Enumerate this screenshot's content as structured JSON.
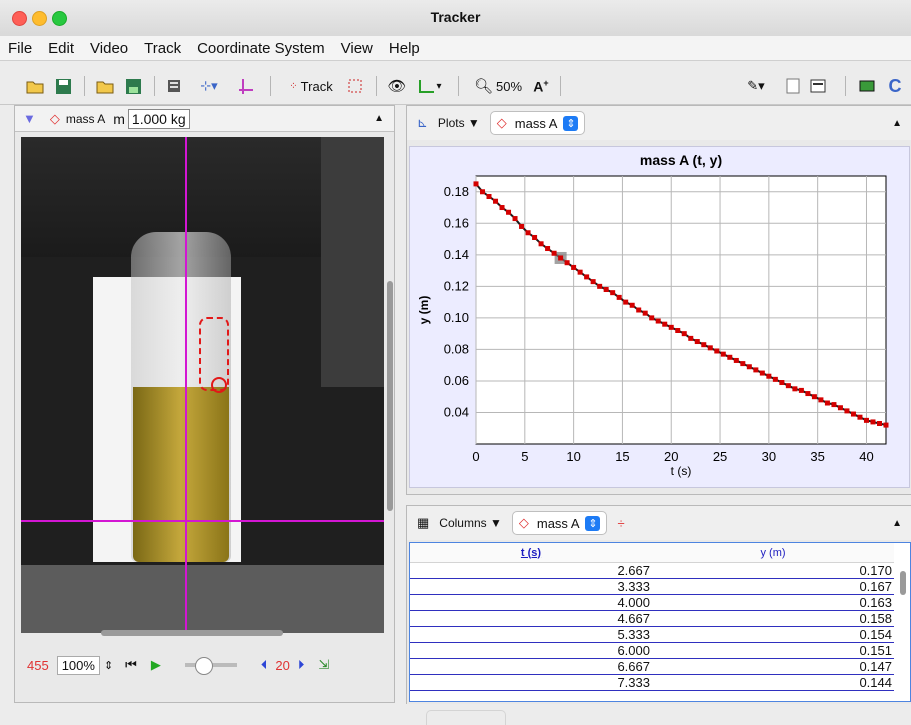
{
  "window": {
    "title": "Tracker"
  },
  "menu": [
    "File",
    "Edit",
    "Video",
    "Track",
    "Coordinate System",
    "View",
    "Help"
  ],
  "toolbar": {
    "track_label": "Track",
    "zoom_label": "50%"
  },
  "video_panel": {
    "track_name": "mass A",
    "mass_label": "m",
    "mass_value": "1.000 kg",
    "frame_number": "455",
    "zoom_value": "100%",
    "step_size": "20"
  },
  "plot_panel": {
    "menu_label": "Plots ▼",
    "track_name": "mass A"
  },
  "chart_data": {
    "type": "scatter",
    "title": "mass A (t, y)",
    "xlabel": "t (s)",
    "ylabel": "y (m)",
    "xlim": [
      0,
      42
    ],
    "ylim": [
      0.02,
      0.19
    ],
    "x_ticks": [
      "0",
      "5",
      "10",
      "15",
      "20",
      "25",
      "30",
      "35",
      "40"
    ],
    "y_ticks": [
      "0.18",
      "0.16",
      "0.14",
      "0.12",
      "0.10",
      "0.08",
      "0.06",
      "0.04"
    ],
    "series": [
      {
        "x": [
          0,
          0.667,
          1.333,
          2,
          2.667,
          3.333,
          4,
          4.667,
          5.333,
          6,
          6.667,
          7.333,
          8,
          8.667,
          9.333,
          10,
          10.667,
          11.333,
          12,
          12.667,
          13.333,
          14,
          14.667,
          15.333,
          16,
          16.667,
          17.333,
          18,
          18.667,
          19.333,
          20,
          20.667,
          21.333,
          22,
          22.667,
          23.333,
          24,
          24.667,
          25.333,
          26,
          26.667,
          27.333,
          28,
          28.667,
          29.333,
          30,
          30.667,
          31.333,
          32,
          32.667,
          33.333,
          34,
          34.667,
          35.333,
          36,
          36.667,
          37.333,
          38,
          38.667,
          39.333,
          40,
          40.667,
          41.333,
          42
        ],
        "y": [
          0.185,
          0.18,
          0.177,
          0.174,
          0.17,
          0.167,
          0.163,
          0.158,
          0.154,
          0.151,
          0.147,
          0.144,
          0.141,
          0.138,
          0.135,
          0.132,
          0.129,
          0.126,
          0.123,
          0.12,
          0.118,
          0.116,
          0.113,
          0.11,
          0.108,
          0.105,
          0.103,
          0.1,
          0.098,
          0.096,
          0.094,
          0.092,
          0.09,
          0.087,
          0.085,
          0.083,
          0.081,
          0.079,
          0.077,
          0.075,
          0.073,
          0.071,
          0.069,
          0.067,
          0.065,
          0.063,
          0.061,
          0.059,
          0.057,
          0.055,
          0.054,
          0.052,
          0.05,
          0.048,
          0.046,
          0.045,
          0.043,
          0.041,
          0.039,
          0.037,
          0.035,
          0.034,
          0.033,
          0.032
        ]
      }
    ],
    "highlight_x": 8.667,
    "grid": true,
    "legend": "none"
  },
  "table_panel": {
    "menu_label": "Columns ▼",
    "track_name": "mass A",
    "columns": [
      "t (s)",
      "y (m)"
    ],
    "rows": [
      [
        "2.667",
        "0.170"
      ],
      [
        "3.333",
        "0.167"
      ],
      [
        "4.000",
        "0.163"
      ],
      [
        "4.667",
        "0.158"
      ],
      [
        "5.333",
        "0.154"
      ],
      [
        "6.000",
        "0.151"
      ],
      [
        "6.667",
        "0.147"
      ],
      [
        "7.333",
        "0.144"
      ]
    ]
  }
}
